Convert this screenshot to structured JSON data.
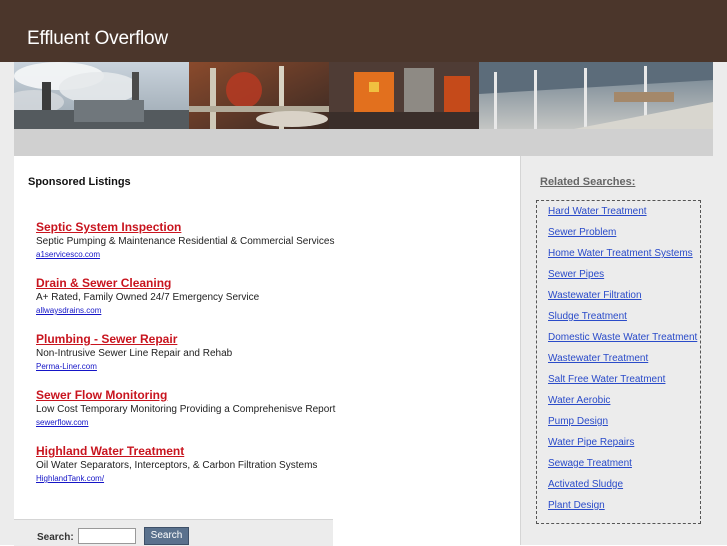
{
  "site": {
    "title": "Effluent Overflow"
  },
  "sponsored": {
    "heading": "Sponsored Listings",
    "listings": [
      {
        "title": "Septic System Inspection",
        "desc": "Septic Pumping & Maintenance Residential & Commercial Services",
        "url": "a1servicesco.com"
      },
      {
        "title": "Drain & Sewer Cleaning",
        "desc": "A+ Rated, Family Owned 24/7 Emergency Service",
        "url": "allwaysdrains.com"
      },
      {
        "title": "Plumbing - Sewer Repair",
        "desc": "Non-Intrusive Sewer Line Repair and Rehab",
        "url": "Perma-Liner.com"
      },
      {
        "title": "Sewer Flow Monitoring",
        "desc": "Low Cost Temporary Monitoring Providing a Comprehenisve Report",
        "url": "sewerflow.com"
      },
      {
        "title": "Highland Water Treatment",
        "desc": "Oil Water Separators, Interceptors, & Carbon Filtration Systems",
        "url": "HighlandTank.com/"
      }
    ]
  },
  "search": {
    "label": "Search:",
    "placeholder": "",
    "button_label": "Search"
  },
  "related": {
    "heading": "Related Searches:",
    "items": [
      "Hard Water Treatment",
      "Sewer Problem",
      "Home Water Treatment Systems",
      "Sewer Pipes",
      "Wastewater Filtration",
      "Sludge Treatment",
      "Domestic Waste Water Treatment",
      "Wastewater Treatment",
      "Salt Free Water Treatment",
      "Water Aerobic",
      "Pump Design",
      "Water Pipe Repairs",
      "Sewage Treatment",
      "Activated Sludge",
      "Plant Design"
    ]
  },
  "colors": {
    "header": "#4b362b",
    "link_red": "#c8141e",
    "link_blue": "#2a4bc9",
    "button": "#5a718d"
  }
}
